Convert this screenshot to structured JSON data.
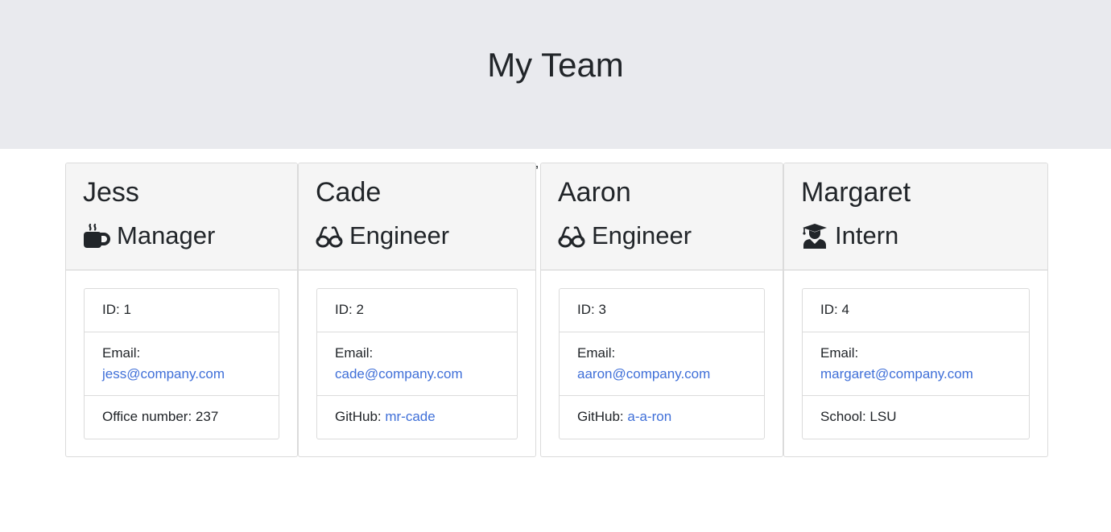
{
  "header": {
    "title": "My Team"
  },
  "stray_text": "’",
  "members": [
    {
      "name": "Jess",
      "role": "Manager",
      "role_icon": "coffee-mug-icon",
      "id_label": "ID: 1",
      "email_label": "Email:",
      "email": "jess@company.com",
      "extra_label": "Office number: 237",
      "extra_link": ""
    },
    {
      "name": "Cade",
      "role": "Engineer",
      "role_icon": "glasses-icon",
      "id_label": "ID: 2",
      "email_label": "Email:",
      "email": "cade@company.com",
      "extra_label": "GitHub: ",
      "extra_link": "mr-cade"
    },
    {
      "name": "Aaron",
      "role": "Engineer",
      "role_icon": "glasses-icon",
      "id_label": "ID: 3",
      "email_label": "Email:",
      "email": "aaron@company.com",
      "extra_label": "GitHub: ",
      "extra_link": "a-a-ron"
    },
    {
      "name": "Margaret",
      "role": "Intern",
      "role_icon": "graduate-icon",
      "id_label": "ID: 4",
      "email_label": "Email:",
      "email": "margaret@company.com",
      "extra_label": "School: LSU",
      "extra_link": ""
    }
  ],
  "colors": {
    "header_bg": "#e9eaee",
    "card_header_bg": "#f5f5f5",
    "link": "#3f6fd8",
    "text": "#212529"
  }
}
